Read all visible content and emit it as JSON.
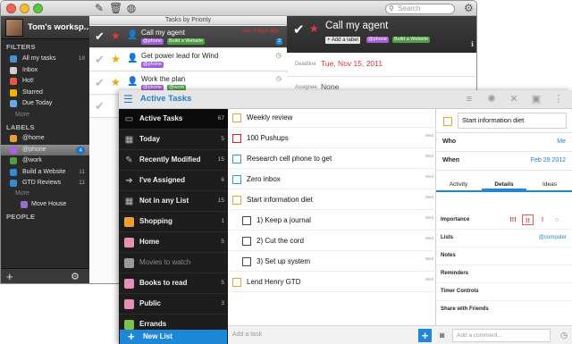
{
  "mac": {
    "search_placeholder": "Search",
    "account_name": "Tom's worksp...",
    "filters_header": "FILTERS",
    "filters": [
      {
        "label": "All my tasks",
        "count": "18",
        "color": "#4a90d9"
      },
      {
        "label": "Inbox",
        "count": "",
        "color": "#cfcfcf"
      },
      {
        "label": "Hot!",
        "count": "",
        "color": "#e85a3a"
      },
      {
        "label": "Starred",
        "count": "",
        "color": "#f0b400"
      },
      {
        "label": "Due Today",
        "count": "",
        "color": "#6aa8e8"
      }
    ],
    "filters_more": "More",
    "labels_header": "LABELS",
    "labels": [
      {
        "label": "@home",
        "count": "",
        "color": "#e8a030"
      },
      {
        "label": "@phone",
        "count": "4",
        "color": "#b05fd8"
      },
      {
        "label": "@work",
        "count": "",
        "color": "#4f9e45"
      },
      {
        "label": "Build a Website",
        "count": "11",
        "color": "#2e8bd6"
      },
      {
        "label": "GTD Reviews",
        "count": "11",
        "color": "#2e8bd6"
      }
    ],
    "labels_more": "More",
    "move_house": "Move House",
    "people_header": "PEOPLE",
    "sort_label": "Tasks by Priority",
    "tasks": [
      {
        "title": "Call my agent",
        "due": "Due 2 days ago",
        "tags": [
          "@phone",
          "Build a Website"
        ],
        "badge": "2"
      },
      {
        "title": "Get power lead for Wind",
        "tags": [
          "@phone"
        ]
      },
      {
        "title": "Work the plan",
        "tags": [
          "@phone",
          "@work"
        ]
      }
    ],
    "detail": {
      "title": "Call my agent",
      "add_label": "+ Add a label",
      "tags": [
        "@phone",
        "Build a Website"
      ],
      "deadline_label": "Deadline",
      "deadline_value": "Tue, Nov 15, 2011",
      "assignee_label": "Assignee",
      "assignee_value": "None"
    }
  },
  "tablet": {
    "title": "Active Tasks",
    "sidebar": [
      {
        "label": "Active Tasks",
        "count": "67",
        "icon": "inbox-icon",
        "dim": false
      },
      {
        "label": "Today",
        "count": "5",
        "icon": "calendar-icon",
        "dim": false
      },
      {
        "label": "Recently Modified",
        "count": "15",
        "icon": "pencil-icon",
        "dim": false
      },
      {
        "label": "I've Assigned",
        "count": "6",
        "icon": "arrow-icon",
        "dim": false
      },
      {
        "label": "Not in any List",
        "count": "15",
        "icon": "calendar-icon",
        "dim": false
      },
      {
        "label": "Shopping",
        "count": "1",
        "icon": "list-orange",
        "dim": false
      },
      {
        "label": "Home",
        "count": "5",
        "icon": "list-pink",
        "dim": false
      },
      {
        "label": "Movies to watch",
        "count": "",
        "icon": "list-gray",
        "dim": true
      },
      {
        "label": "Books to read",
        "count": "5",
        "icon": "list-pink",
        "dim": false
      },
      {
        "label": "Public",
        "count": "3",
        "icon": "list-pink",
        "dim": false
      },
      {
        "label": "Errands",
        "count": "",
        "icon": "list-green",
        "dim": false
      }
    ],
    "new_list": "New List",
    "tasks": [
      {
        "title": "Weekly review",
        "day": "",
        "color": "orange",
        "indent": false
      },
      {
        "title": "100 Pushups",
        "day": "Wed",
        "color": "red",
        "indent": false
      },
      {
        "title": "Research cell phone  to get",
        "day": "Wed",
        "color": "blue",
        "indent": false
      },
      {
        "title": "Zero inbox",
        "day": "Wed",
        "color": "blue",
        "indent": false
      },
      {
        "title": "Start information diet",
        "day": "Wed",
        "color": "orange",
        "indent": false
      },
      {
        "title": "1) Keep a journal",
        "day": "Wed",
        "color": "gray",
        "indent": true
      },
      {
        "title": "2) Cut the cord",
        "day": "Wed",
        "color": "gray",
        "indent": true
      },
      {
        "title": "3) Set up system",
        "day": "Wed",
        "color": "gray",
        "indent": true
      },
      {
        "title": "Lend Henry GTD",
        "day": "Wed",
        "color": "orange",
        "indent": false
      }
    ],
    "add_task_placeholder": "Add a task",
    "detail": {
      "title": "Start information diet",
      "who_label": "Who",
      "who_value": "Me",
      "when_label": "When",
      "when_value": "Feb 29 2012",
      "tabs": [
        "Activity",
        "Details",
        "Ideas"
      ],
      "active_tab": "Details",
      "importance_label": "Importance",
      "importance_options": [
        "!!!",
        "!!",
        "!",
        "○"
      ],
      "lists_label": "Lists",
      "lists_value": "@computer",
      "notes_label": "Notes",
      "reminders_label": "Reminders",
      "timer_label": "Timer Controls",
      "share_label": "Share with Friends",
      "comment_placeholder": "Add a comment..."
    }
  }
}
